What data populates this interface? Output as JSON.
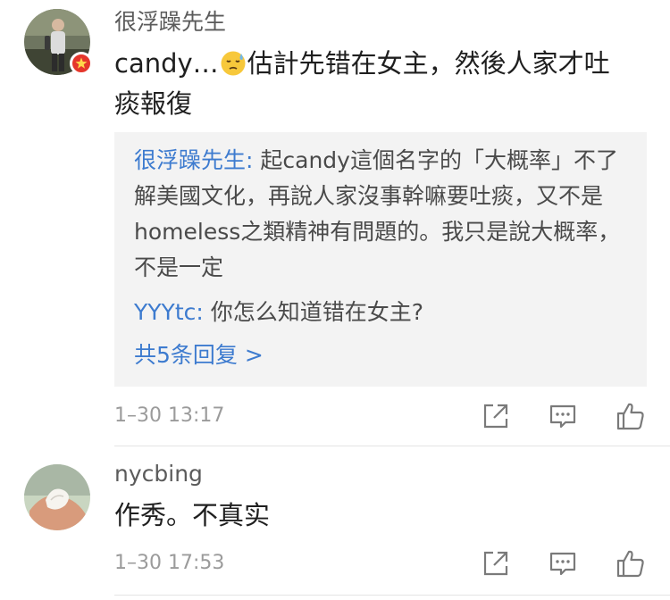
{
  "comments": [
    {
      "username": "很浮躁先生",
      "text_before_emoji": "candy…",
      "emoji": "sweat-emoji",
      "text_after_emoji": "估計先错在女主，然後人家才吐",
      "text_line2": "痰報復",
      "replies": [
        {
          "name": "很浮躁先生:",
          "text": " 起candy這個名字的「大概率」不了解美國文化，再說人家沒事幹嘛要吐痰，又不是homeless之類精神有問題的。我只是說大概率，不是一定"
        },
        {
          "name": "YYYtc:",
          "text": " 你怎么知道错在女主?"
        }
      ],
      "replies_more": "共5条回复 >",
      "timestamp": "1–30 13:17"
    },
    {
      "username": "nycbing",
      "text": "作秀。不真实",
      "timestamp": "1–30 17:53"
    }
  ],
  "icons": {
    "share": "share-icon",
    "comment": "comment-icon",
    "like": "thumbs-up-icon"
  },
  "colors": {
    "link_blue": "#3d7bcf",
    "username_gray": "#5b5b5b",
    "timestamp_gray": "#9b9b9b",
    "reply_bg": "#f3f3f3",
    "badge_red": "#e5362b"
  }
}
